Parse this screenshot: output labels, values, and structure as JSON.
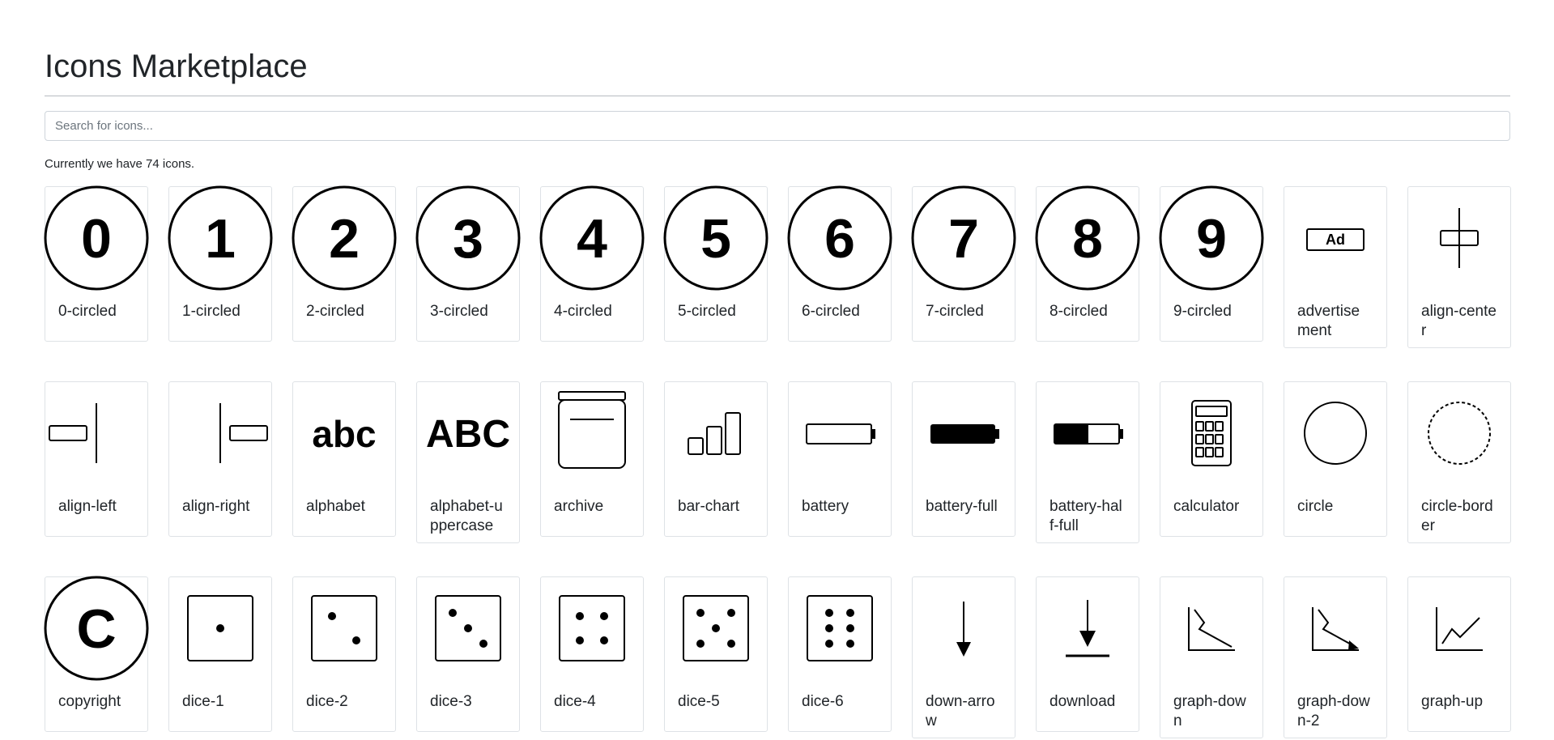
{
  "page": {
    "title": "Icons Marketplace",
    "search_placeholder": "Search for icons...",
    "count_text": "Currently we have 74 icons."
  },
  "icons": [
    {
      "label": "0-circled",
      "icon": "0-circled-icon"
    },
    {
      "label": "1-circled",
      "icon": "1-circled-icon"
    },
    {
      "label": "2-circled",
      "icon": "2-circled-icon"
    },
    {
      "label": "3-circled",
      "icon": "3-circled-icon"
    },
    {
      "label": "4-circled",
      "icon": "4-circled-icon"
    },
    {
      "label": "5-circled",
      "icon": "5-circled-icon"
    },
    {
      "label": "6-circled",
      "icon": "6-circled-icon"
    },
    {
      "label": "7-circled",
      "icon": "7-circled-icon"
    },
    {
      "label": "8-circled",
      "icon": "8-circled-icon"
    },
    {
      "label": "9-circled",
      "icon": "9-circled-icon"
    },
    {
      "label": "advertise ment",
      "icon": "advertisement-icon"
    },
    {
      "label": "align-center",
      "icon": "align-center-icon"
    },
    {
      "label": "align-left",
      "icon": "align-left-icon"
    },
    {
      "label": "align-right",
      "icon": "align-right-icon"
    },
    {
      "label": "alphabet",
      "icon": "alphabet-icon"
    },
    {
      "label": "alphabet-uppercase",
      "icon": "alphabet-uppercase-icon"
    },
    {
      "label": "archive",
      "icon": "archive-icon"
    },
    {
      "label": "bar-chart",
      "icon": "bar-chart-icon"
    },
    {
      "label": "battery",
      "icon": "battery-icon"
    },
    {
      "label": "battery-full",
      "icon": "battery-full-icon"
    },
    {
      "label": "battery-half-full",
      "icon": "battery-half-full-icon"
    },
    {
      "label": "calculator",
      "icon": "calculator-icon"
    },
    {
      "label": "circle",
      "icon": "circle-icon"
    },
    {
      "label": "circle-border",
      "icon": "circle-border-icon"
    },
    {
      "label": "copyright",
      "icon": "copyright-icon"
    },
    {
      "label": "dice-1",
      "icon": "dice-1-icon"
    },
    {
      "label": "dice-2",
      "icon": "dice-2-icon"
    },
    {
      "label": "dice-3",
      "icon": "dice-3-icon"
    },
    {
      "label": "dice-4",
      "icon": "dice-4-icon"
    },
    {
      "label": "dice-5",
      "icon": "dice-5-icon"
    },
    {
      "label": "dice-6",
      "icon": "dice-6-icon"
    },
    {
      "label": "down-arrow",
      "icon": "down-arrow-icon"
    },
    {
      "label": "download",
      "icon": "download-icon"
    },
    {
      "label": "graph-down",
      "icon": "graph-down-icon"
    },
    {
      "label": "graph-down-2",
      "icon": "graph-down-2-icon"
    },
    {
      "label": "graph-up",
      "icon": "graph-up-icon"
    }
  ]
}
